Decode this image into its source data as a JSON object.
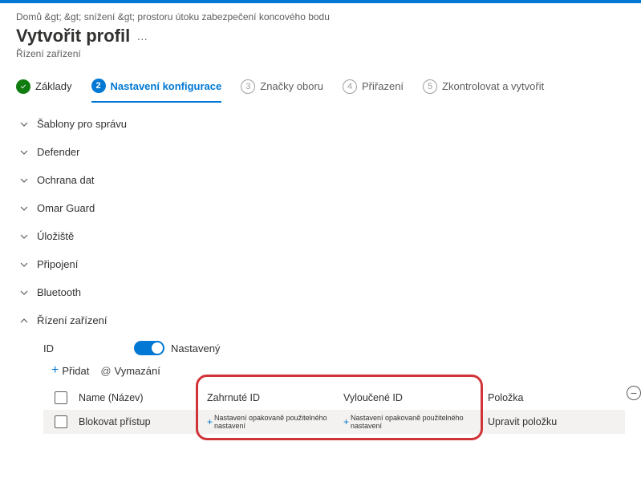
{
  "breadcrumb": "Domů &gt;   &gt; snížení &gt; prostoru útoku zabezpečení koncového bodu",
  "page_title": "Vytvořit profil",
  "subtitle": "Řízení zařízení",
  "steps": {
    "s1": {
      "num": "✓",
      "label": "Základy"
    },
    "s2": {
      "num": "2",
      "label": "Nastavení konfigurace"
    },
    "s3": {
      "num": "3",
      "label": "Značky oboru"
    },
    "s4": {
      "num": "4",
      "label": "Přiřazení"
    },
    "s5": {
      "num": "5",
      "label": "Zkontrolovat a vytvořit"
    }
  },
  "accordion": {
    "a0": "Šablony pro správu",
    "a1": "Defender",
    "a2": "Ochrana dat",
    "a3": "Omar Guard",
    "a4": "Úložiště",
    "a5": "Připojení",
    "a6": "Bluetooth",
    "a7": "Řízení zařízení"
  },
  "device_control": {
    "id_label": "ID",
    "toggle_label": "Nastavený",
    "add_label": "Přidat",
    "clear_label": "Vymazání"
  },
  "table": {
    "headers": {
      "name": "Name (Název)",
      "included": "Zahrnuté ID",
      "excluded": "Vyloučené ID",
      "item": "Položka"
    },
    "row": {
      "name": "Blokovat přístup",
      "incl_link": "Nastavení opakovaně použitelného nastavení",
      "excl_link": "Nastavení opakovaně použitelného nastavení",
      "item_link": "Upravit položku"
    }
  }
}
